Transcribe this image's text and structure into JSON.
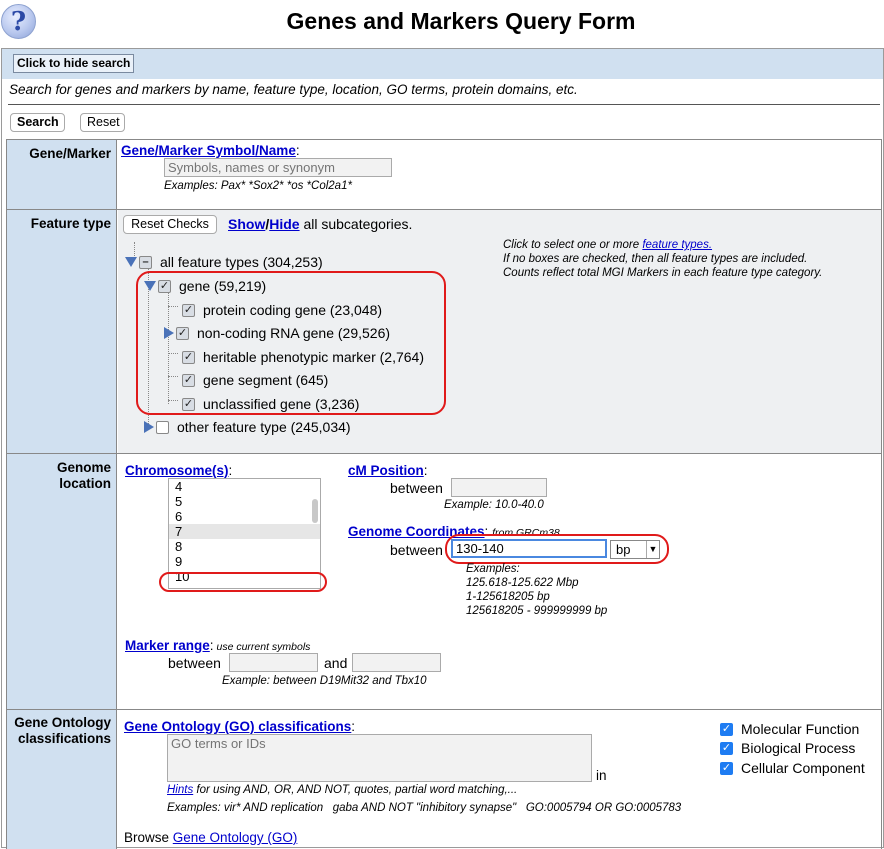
{
  "header": {
    "help_icon": "question-mark-icon",
    "title": "Genes and Markers Query Form"
  },
  "toolbar": {
    "hide_search": "Click to hide search",
    "intro": "Search for genes and markers by name, feature type, location, GO terms, protein domains, etc.",
    "search": "Search",
    "reset": "Reset"
  },
  "gene_marker": {
    "label": "Gene/Marker",
    "link": "Gene/Marker Symbol/Name",
    "colon": ":",
    "placeholder": "Symbols, names or synonym",
    "examples": "Examples: Pax* *Sox2* *os *Col2a1*"
  },
  "feature_type": {
    "label": "Feature type",
    "reset_checks": "Reset Checks",
    "show": "Show",
    "slash": "/",
    "hide": "Hide",
    "subcats": " all subcategories.",
    "help_1": "Click to select one or more ",
    "help_link": "feature types.",
    "help_2": "If no boxes are checked, then all feature types are included.",
    "help_3": "Counts reflect total MGI Markers in each feature type category.",
    "all": "all feature types (304,253)",
    "gene": "gene (59,219)",
    "items": [
      "protein coding gene (23,048)",
      "non-coding RNA gene (29,526)",
      "heritable phenotypic marker (2,764)",
      "gene segment (645)",
      "unclassified gene (3,236)"
    ],
    "other": "other feature type (245,034)"
  },
  "genome": {
    "label": "Genome location",
    "chromosome_link": "Chromosome(s)",
    "colon": ":",
    "chromosomes": [
      "4",
      "5",
      "6",
      "7",
      "8",
      "9",
      "10"
    ],
    "selected_chromosome": "7",
    "cm_link": "cM Position",
    "between": "between",
    "cm_example": "Example: 10.0-40.0",
    "coords_link": "Genome Coordinates",
    "coords_from": "from GRCm38",
    "coords_value": "130-140",
    "unit": "bp",
    "examples_title": "Examples:",
    "examples": [
      "125.618-125.622 Mbp",
      "1-125618205 bp",
      "125618205 - 999999999 bp"
    ],
    "marker_link": "Marker range",
    "marker_note": " use current symbols",
    "and": "and",
    "marker_example": "Example: between D19Mit32 and Tbx10"
  },
  "go": {
    "label": "Gene Ontology classifications",
    "link": "Gene Ontology (GO) classifications",
    "colon": ":",
    "placeholder": "GO terms or IDs",
    "in": "in",
    "hints_link": "Hints",
    "hints_text": " for using AND, OR, AND NOT, quotes, partial word matching,...",
    "examples": "Examples: vir* AND replication   gaba AND NOT \"inhibitory synapse\"   GO:0005794 OR GO:0005783",
    "checks": [
      "Molecular Function",
      "Biological Process",
      "Cellular Component"
    ],
    "browse": "Browse ",
    "browse_link": "Gene Ontology (GO)"
  }
}
